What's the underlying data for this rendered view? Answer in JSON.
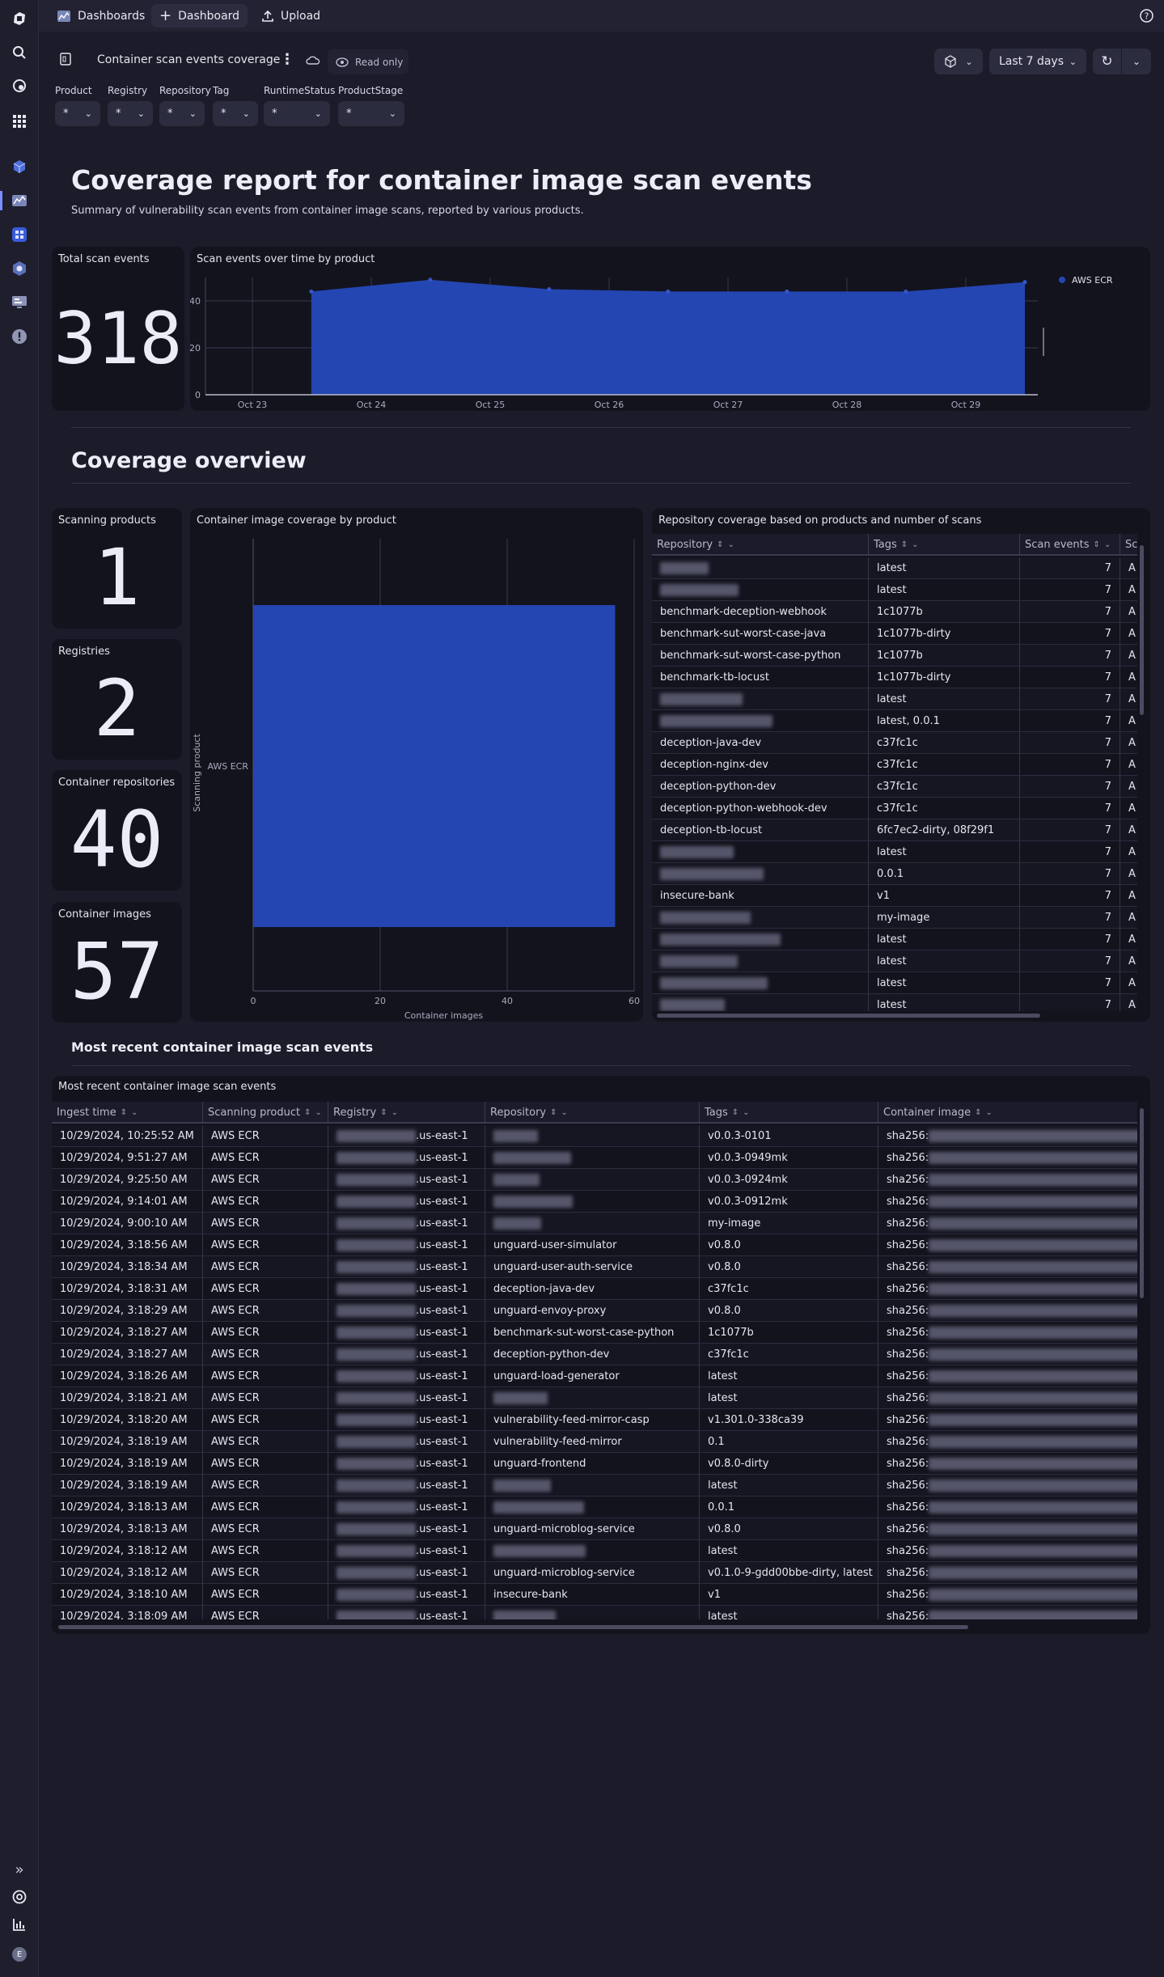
{
  "topbar": {
    "items": [
      {
        "label": "Dashboards",
        "icon": "dashboards-app-icon"
      },
      {
        "label": "Dashboard",
        "icon": "plus-icon"
      },
      {
        "label": "Upload",
        "icon": "upload-icon"
      }
    ],
    "help_icon": "help-icon"
  },
  "dashboard": {
    "title": "Container scan events coverage",
    "read_only": "Read only",
    "timeframe": "Last 7 days",
    "filters": [
      {
        "label": "Product",
        "value": "*"
      },
      {
        "label": "Registry",
        "value": "*"
      },
      {
        "label": "Repository",
        "value": "*"
      },
      {
        "label": "Tag",
        "value": "*"
      },
      {
        "label": "RuntimeStatus",
        "value": "*"
      },
      {
        "label": "ProductStage",
        "value": "*"
      }
    ]
  },
  "header": {
    "title": "Coverage report for container image scan events",
    "subtitle": "Summary of vulnerability scan events from container image scans, reported by various products."
  },
  "total": {
    "title": "Total scan events",
    "value": "318"
  },
  "section2": {
    "title": "Coverage overview"
  },
  "stats": [
    {
      "title": "Scanning products",
      "value": "1"
    },
    {
      "title": "Registries",
      "value": "2"
    },
    {
      "title": "Container repositories",
      "value": "40"
    },
    {
      "title": "Container images",
      "value": "57"
    }
  ],
  "section3": {
    "title": "Most recent container image scan events"
  },
  "chart_data": [
    {
      "type": "area",
      "title": "Scan events over time by product",
      "x": [
        "Oct 23",
        "Oct 24",
        "Oct 25",
        "Oct 26",
        "Oct 27",
        "Oct 28",
        "Oct 29"
      ],
      "x_ticks": [
        "Oct 23",
        "Oct 24",
        "Oct 25",
        "Oct 26",
        "Oct 27",
        "Oct 28",
        "Oct 29"
      ],
      "series": [
        {
          "name": "AWS ECR",
          "values": [
            44,
            49,
            45,
            44,
            44,
            44,
            48
          ],
          "color": "#2446b2"
        }
      ],
      "ylim": [
        0,
        50
      ],
      "y_ticks": [
        0,
        20,
        40
      ],
      "grid": true,
      "legend": "right"
    },
    {
      "type": "bar",
      "orientation": "horizontal",
      "title": "Container image coverage by product",
      "categories": [
        "AWS ECR"
      ],
      "values": [
        57
      ],
      "xlabel": "Container images",
      "ylabel": "Scanning product",
      "xlim": [
        0,
        60
      ],
      "x_ticks": [
        0,
        20,
        40,
        60
      ],
      "grid": true,
      "color": "#2446b2"
    }
  ],
  "repo_table": {
    "title": "Repository coverage based on products and number of scans",
    "columns": [
      "Repository",
      "Tags",
      "Scan events",
      "Sc"
    ],
    "rows": [
      [
        null,
        "latest",
        "7",
        "A"
      ],
      [
        null,
        "latest",
        "7",
        "A"
      ],
      [
        "benchmark-deception-webhook",
        "1c1077b",
        "7",
        "A"
      ],
      [
        "benchmark-sut-worst-case-java",
        "1c1077b-dirty",
        "7",
        "A"
      ],
      [
        "benchmark-sut-worst-case-python",
        "1c1077b",
        "7",
        "A"
      ],
      [
        "benchmark-tb-locust",
        "1c1077b-dirty",
        "7",
        "A"
      ],
      [
        null,
        "latest",
        "7",
        "A"
      ],
      [
        null,
        "latest, 0.0.1",
        "7",
        "A"
      ],
      [
        "deception-java-dev",
        "c37fc1c",
        "7",
        "A"
      ],
      [
        "deception-nginx-dev",
        "c37fc1c",
        "7",
        "A"
      ],
      [
        "deception-python-dev",
        "c37fc1c",
        "7",
        "A"
      ],
      [
        "deception-python-webhook-dev",
        "c37fc1c",
        "7",
        "A"
      ],
      [
        "deception-tb-locust",
        "6fc7ec2-dirty, 08f29f1",
        "7",
        "A"
      ],
      [
        null,
        "latest",
        "7",
        "A"
      ],
      [
        null,
        "0.0.1",
        "7",
        "A"
      ],
      [
        "insecure-bank",
        "v1",
        "7",
        "A"
      ],
      [
        null,
        "my-image",
        "7",
        "A"
      ],
      [
        null,
        "latest",
        "7",
        "A"
      ],
      [
        null,
        "latest",
        "7",
        "A"
      ],
      [
        null,
        "latest",
        "7",
        "A"
      ],
      [
        null,
        "latest",
        "7",
        "A"
      ]
    ]
  },
  "events_table": {
    "title": "Most recent container image scan events",
    "columns": [
      "Ingest time",
      "Scanning product",
      "Registry",
      "Repository",
      "Tags",
      "Container image"
    ],
    "registry_suffix": ".us-east-1",
    "image_prefix": "sha256:",
    "rows": [
      [
        "10/29/2024, 10:25:52 AM",
        "AWS ECR",
        null,
        "v0.0.3-0101"
      ],
      [
        "10/29/2024, 9:51:27 AM",
        "AWS ECR",
        null,
        "v0.0.3-0949mk"
      ],
      [
        "10/29/2024, 9:25:50 AM",
        "AWS ECR",
        null,
        "v0.0.3-0924mk"
      ],
      [
        "10/29/2024, 9:14:01 AM",
        "AWS ECR",
        null,
        "v0.0.3-0912mk"
      ],
      [
        "10/29/2024, 9:00:10 AM",
        "AWS ECR",
        null,
        "my-image"
      ],
      [
        "10/29/2024, 3:18:56 AM",
        "AWS ECR",
        "unguard-user-simulator",
        "v0.8.0"
      ],
      [
        "10/29/2024, 3:18:34 AM",
        "AWS ECR",
        "unguard-user-auth-service",
        "v0.8.0"
      ],
      [
        "10/29/2024, 3:18:31 AM",
        "AWS ECR",
        "deception-java-dev",
        "c37fc1c"
      ],
      [
        "10/29/2024, 3:18:29 AM",
        "AWS ECR",
        "unguard-envoy-proxy",
        "v0.8.0"
      ],
      [
        "10/29/2024, 3:18:27 AM",
        "AWS ECR",
        "benchmark-sut-worst-case-python",
        "1c1077b"
      ],
      [
        "10/29/2024, 3:18:27 AM",
        "AWS ECR",
        "deception-python-dev",
        "c37fc1c"
      ],
      [
        "10/29/2024, 3:18:26 AM",
        "AWS ECR",
        "unguard-load-generator",
        "latest"
      ],
      [
        "10/29/2024, 3:18:21 AM",
        "AWS ECR",
        null,
        "latest"
      ],
      [
        "10/29/2024, 3:18:20 AM",
        "AWS ECR",
        "vulnerability-feed-mirror-casp",
        "v1.301.0-338ca39"
      ],
      [
        "10/29/2024, 3:18:19 AM",
        "AWS ECR",
        "vulnerability-feed-mirror",
        "0.1"
      ],
      [
        "10/29/2024, 3:18:19 AM",
        "AWS ECR",
        "unguard-frontend",
        "v0.8.0-dirty"
      ],
      [
        "10/29/2024, 3:18:19 AM",
        "AWS ECR",
        null,
        "latest"
      ],
      [
        "10/29/2024, 3:18:13 AM",
        "AWS ECR",
        null,
        "0.0.1"
      ],
      [
        "10/29/2024, 3:18:13 AM",
        "AWS ECR",
        "unguard-microblog-service",
        "v0.8.0"
      ],
      [
        "10/29/2024, 3:18:12 AM",
        "AWS ECR",
        null,
        "latest"
      ],
      [
        "10/29/2024, 3:18:12 AM",
        "AWS ECR",
        "unguard-microblog-service",
        "v0.1.0-9-gdd00bbe-dirty, latest"
      ],
      [
        "10/29/2024, 3:18:10 AM",
        "AWS ECR",
        "insecure-bank",
        "v1"
      ],
      [
        "10/29/2024, 3:18:09 AM",
        "AWS ECR",
        null,
        "latest"
      ]
    ]
  },
  "sidebar": {
    "user_initial": "E"
  },
  "colors": {
    "accent": "#2446b2",
    "background": "#1b1b29",
    "tile": "#13131e"
  }
}
